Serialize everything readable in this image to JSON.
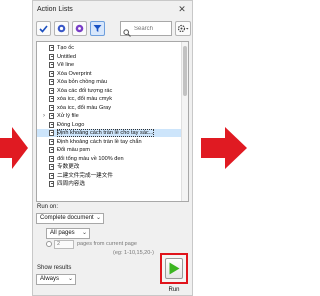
{
  "window": {
    "title": "Action Lists",
    "close_glyph": "✕"
  },
  "toolbar": {
    "buttons": [
      {
        "icon": "check-icon"
      },
      {
        "icon": "record-icon"
      },
      {
        "icon": "gear-badge-icon"
      },
      {
        "icon": "filter-icon"
      }
    ],
    "search_placeholder": "Search",
    "options_icon": "gear-dropdown-icon"
  },
  "actions": [
    {
      "label": "Tạo ốc",
      "expandable": false
    },
    {
      "label": "Untitled",
      "expandable": false
    },
    {
      "label": "Vẽ line",
      "expandable": false
    },
    {
      "label": "Xóa Overprint",
      "expandable": false
    },
    {
      "label": "Xóa bỏn chồng màu",
      "expandable": false
    },
    {
      "label": "Xóa các đối tượng rác",
      "expandable": false
    },
    {
      "label": "xóa icc, đổi màu cmyk",
      "expandable": false
    },
    {
      "label": "xóa icc, đổi màu Gray",
      "expandable": false
    },
    {
      "label": "Xử lý file",
      "expandable": true
    },
    {
      "label": "Đóng Logo",
      "expandable": false
    },
    {
      "label": "Định khoảng cách tràn lề cho tay sác...",
      "expandable": false,
      "selected": true
    },
    {
      "label": "Định khoảng cách tràn lề tay chắn",
      "expandable": false
    },
    {
      "label": "Đổi màu psm",
      "expandable": false
    },
    {
      "label": "đổi tổng màu về 100% đen",
      "expandable": false
    },
    {
      "label": "专数更改",
      "expandable": false
    },
    {
      "label": "二建文件完成一建文件",
      "expandable": false
    },
    {
      "label": "四周内容选",
      "expandable": false
    }
  ],
  "run_on": {
    "label": "Run on:",
    "target": "Complete document",
    "pages": "All pages",
    "count": "2",
    "count_suffix": "pages from current page",
    "example": "(eg: 1-10,15,20-)"
  },
  "show_results": {
    "label": "Show results",
    "value": "Always"
  },
  "run": {
    "label": "Run",
    "accent": "#3cb521",
    "highlight": "#e0141c"
  }
}
